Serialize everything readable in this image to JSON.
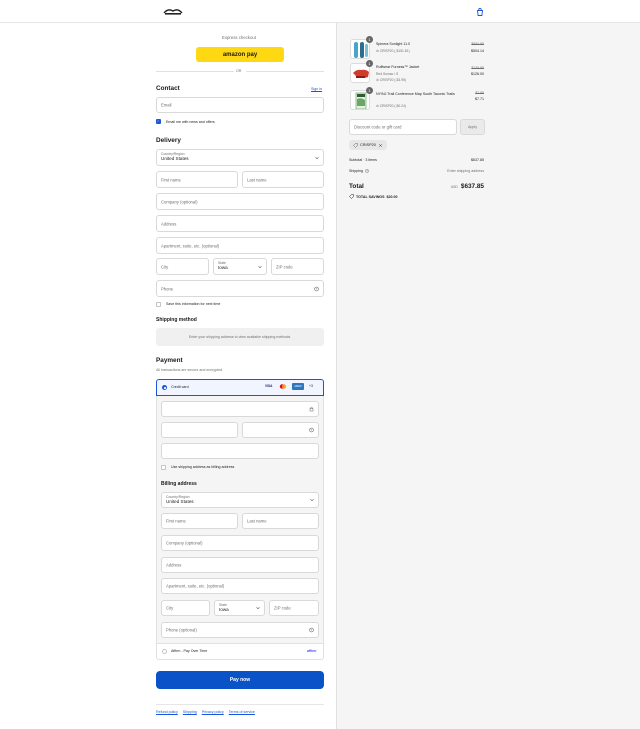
{
  "header": {
    "logo_alt": "store-logo"
  },
  "express": {
    "label": "Express checkout",
    "amazon_pay": "amazon pay",
    "or": "OR"
  },
  "contact": {
    "title": "Contact",
    "sign_in": "Sign in",
    "email_placeholder": "Email",
    "newsletter_label": "Email me with news and offers"
  },
  "delivery": {
    "title": "Delivery",
    "country_label": "Country/Region",
    "country_value": "United States",
    "first_name": "First name",
    "last_name": "Last name",
    "company": "Company (optional)",
    "address": "Address",
    "apartment": "Apartment, suite, etc. (optional)",
    "city": "City",
    "state_label": "State",
    "state_value": "Iowa",
    "zip": "ZIP code",
    "phone": "Phone",
    "save_info": "Save this information for next time"
  },
  "shipping_method": {
    "title": "Shipping method",
    "message": "Enter your shipping address to view available shipping methods."
  },
  "payment": {
    "title": "Payment",
    "subtitle": "All transactions are secure and encrypted.",
    "credit_card_label": "Credit card",
    "card_brands": [
      "VISA",
      "MC",
      "AMEX",
      "+3"
    ],
    "billing_same": "Use shipping address as billing address",
    "affirm_label": "Affirm - Pay Over Time",
    "affirm_logo": "affirm",
    "pay_button": "Pay now"
  },
  "billing": {
    "title": "Billing address",
    "country_label": "Country/Region",
    "country_value": "United States",
    "first_name": "First name",
    "last_name": "Last name",
    "company": "Company (optional)",
    "address": "Address",
    "apartment": "Apartment, suite, etc. (optional)",
    "city": "City",
    "state_label": "State",
    "state_value": "Iowa",
    "zip": "ZIP code",
    "phone": "Phone (optional)"
  },
  "footer_links": [
    "Refund policy",
    "Shipping",
    "Privacy policy",
    "Terms of service"
  ],
  "order": {
    "items": [
      {
        "qty": "1",
        "name": "Spinera Sunlight 11.0",
        "variant": "",
        "discount": "CRISP20 (-$151.81)",
        "old_price": "$654.95",
        "price": "$504.14",
        "thumb_color": "#4aa3c9"
      },
      {
        "qty": "1",
        "name": "Ruffwear Furness™ Jacket",
        "variant": "Red Sumac / S",
        "discount": "CRISP20 (-$3.95)",
        "old_price": "$129.95",
        "price": "$126.00",
        "thumb_color": "#d23a2a"
      },
      {
        "qty": "1",
        "name": "NY/NJ Trail Conference Map South Taconic Trails",
        "variant": "",
        "discount": "CRISP20 (-$0.24)",
        "old_price": "$7.95",
        "price": "$7.71",
        "thumb_color": "#6aa56a"
      }
    ],
    "discount_placeholder": "Discount code or gift card",
    "apply_label": "Apply",
    "applied_code": "CRISP20",
    "subtotal_label": "Subtotal · 3 items",
    "subtotal_value": "$637.85",
    "shipping_label": "Shipping",
    "shipping_value": "Enter shipping address",
    "total_label": "Total",
    "currency": "USD",
    "total_value": "$637.85",
    "savings_label": "TOTAL SAVINGS",
    "savings_value": "$20.00"
  },
  "colors": {
    "accent": "#0a52c7",
    "amazon": "#ffd814",
    "panel": "#f5f5f5"
  }
}
